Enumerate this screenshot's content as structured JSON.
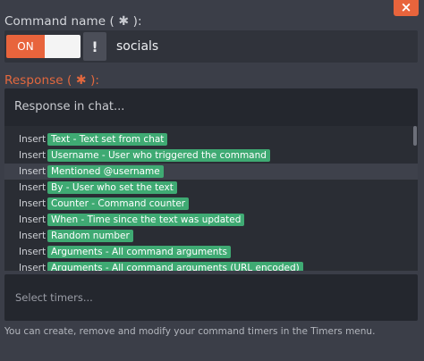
{
  "close_label": "×",
  "command_name": {
    "label": "Command name (",
    "label_suffix": "):",
    "star": "✱",
    "toggle_on": "ON",
    "warn": "!",
    "value": "socials"
  },
  "response": {
    "label": "Response (",
    "label_suffix": "):",
    "star": "✱",
    "placeholder": "Response in chat..."
  },
  "insert_word": "Insert",
  "insert_items": [
    "Text - Text set from chat",
    "Username - User who triggered the command",
    "Mentioned @username",
    "By - User who set the text",
    "Counter - Command counter",
    "When - Time since the text was updated",
    "Random number",
    "Arguments - All command arguments",
    "Arguments - All command arguments (URL encoded)"
  ],
  "highlighted_index": 2,
  "timers": {
    "placeholder": "Select timers..."
  },
  "hint": "You can create, remove and modify your command timers in the Timers menu.",
  "colors": {
    "accent": "#e8643c",
    "tag_green": "#3faa73",
    "background": "#3b3e48"
  }
}
